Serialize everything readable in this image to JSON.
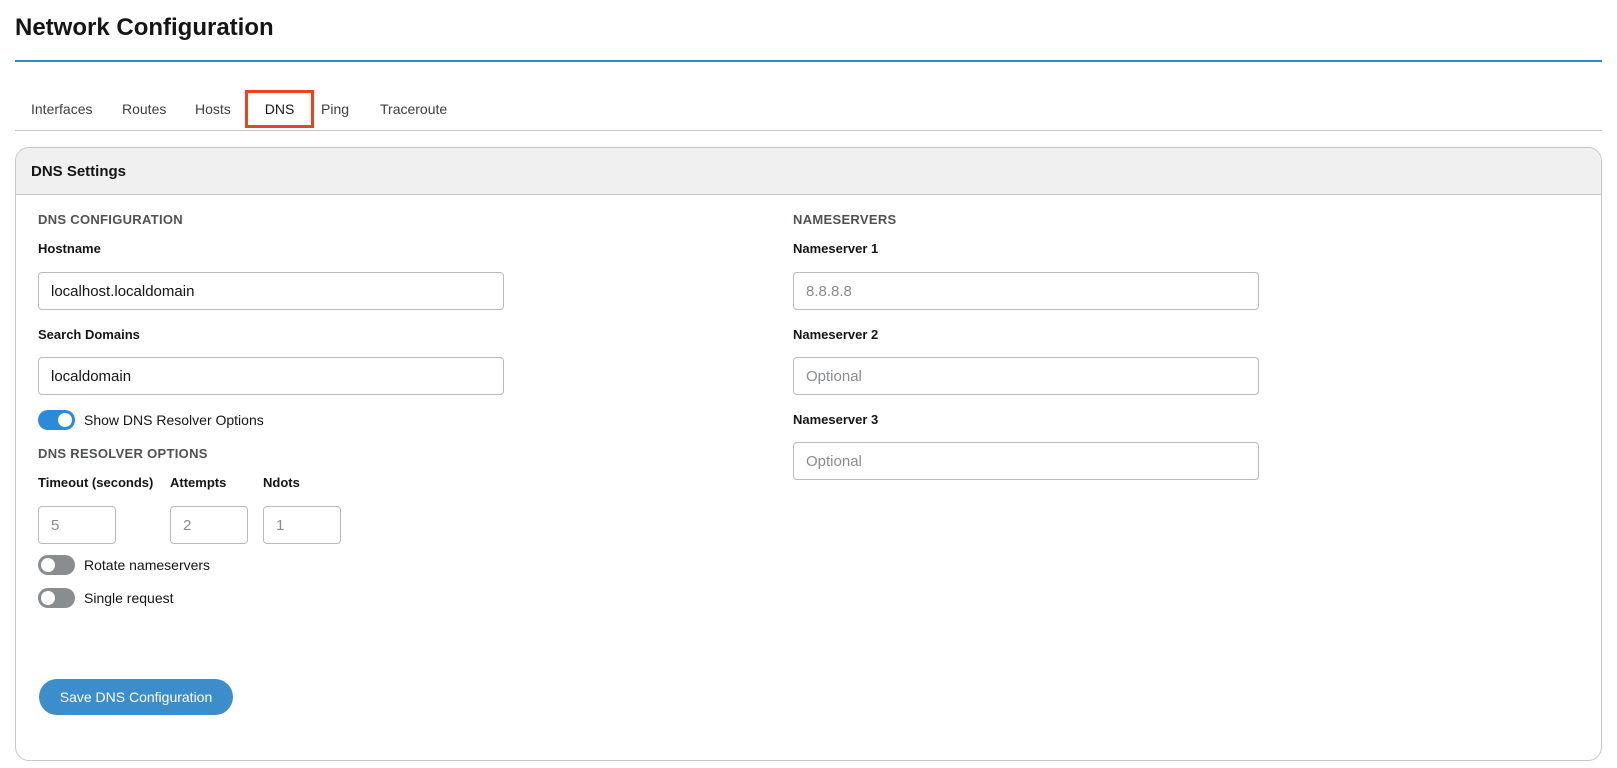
{
  "page": {
    "title": "Network Configuration"
  },
  "tabs": [
    {
      "label": "Interfaces"
    },
    {
      "label": "Routes"
    },
    {
      "label": "Hosts"
    },
    {
      "label": "DNS",
      "active": true
    },
    {
      "label": "Ping"
    },
    {
      "label": "Traceroute"
    }
  ],
  "card": {
    "title": "DNS Settings",
    "dns_config": {
      "heading": "DNS CONFIGURATION",
      "hostname_label": "Hostname",
      "hostname_value": "localhost.localdomain",
      "search_domains_label": "Search Domains",
      "search_domains_value": "localdomain",
      "show_resolver_label": "Show DNS Resolver Options",
      "show_resolver_on": true
    },
    "resolver": {
      "heading": "DNS RESOLVER OPTIONS",
      "timeout_label": "Timeout (seconds)",
      "timeout_placeholder": "5",
      "attempts_label": "Attempts",
      "attempts_placeholder": "2",
      "ndots_label": "Ndots",
      "ndots_placeholder": "1",
      "rotate_label": "Rotate nameservers",
      "rotate_on": false,
      "single_request_label": "Single request",
      "single_request_on": false
    },
    "nameservers": {
      "heading": "NAMESERVERS",
      "ns1_label": "Nameserver 1",
      "ns1_placeholder": "8.8.8.8",
      "ns2_label": "Nameserver 2",
      "ns2_placeholder": "Optional",
      "ns3_label": "Nameserver 3",
      "ns3_placeholder": "Optional"
    },
    "save_label": "Save DNS Configuration"
  },
  "colors": {
    "accent": "#2b8ad9",
    "button": "#3c8dcc",
    "active_tab_outline": "#e84322"
  }
}
